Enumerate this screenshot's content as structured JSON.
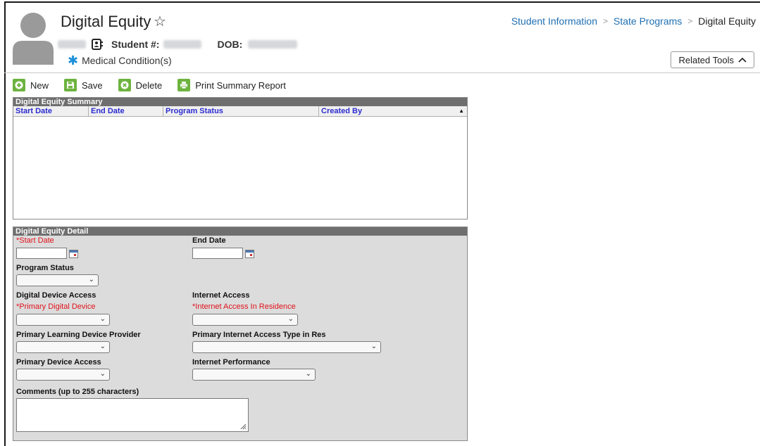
{
  "header": {
    "title": "Digital Equity",
    "student_label": "Student #:",
    "dob_label": "DOB:",
    "medical": "Medical Condition(s)",
    "related_tools": "Related Tools"
  },
  "breadcrumb": {
    "item1": "Student Information",
    "item2": "State Programs",
    "current": "Digital Equity"
  },
  "toolbar": {
    "new": "New",
    "save": "Save",
    "delete": "Delete",
    "print": "Print Summary Report"
  },
  "summary": {
    "title": "Digital Equity Summary",
    "columns": [
      "Start Date",
      "End Date",
      "Program Status",
      "Created By"
    ]
  },
  "detail": {
    "title": "Digital Equity Detail",
    "start_date": "*Start Date",
    "end_date": "End Date",
    "program_status": "Program Status",
    "digital_device_access": "Digital Device Access",
    "internet_access": "Internet Access",
    "primary_digital_device": "*Primary Digital Device",
    "internet_access_in_residence": "*Internet Access In Residence",
    "primary_learning_device_provider": "Primary Learning Device Provider",
    "primary_internet_access_type": "Primary Internet Access Type in Res",
    "primary_device_access": "Primary Device Access",
    "internet_performance": "Internet Performance",
    "comments": "Comments (up to 255 characters)"
  },
  "colors": {
    "accent_green": "#6db33f",
    "link_blue": "#1f6fb2",
    "required_red": "#e0121b",
    "column_header_blue": "#2b2bd0",
    "panel_title_gray": "#6f6f6f"
  }
}
